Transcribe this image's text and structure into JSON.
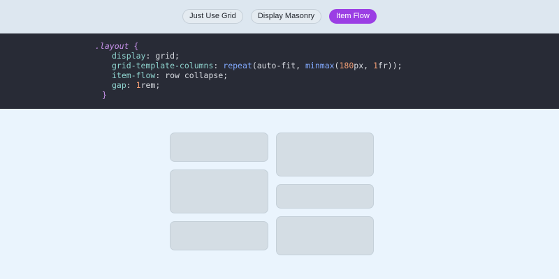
{
  "tabs": [
    {
      "label": "Just Use Grid",
      "active": false
    },
    {
      "label": "Display Masonry",
      "active": false
    },
    {
      "label": "Item Flow",
      "active": true
    }
  ],
  "code": {
    "selector": ".layout",
    "open_brace": "{",
    "close_brace": "}",
    "display_prop": "display",
    "display_val": "grid",
    "gtc_prop": "grid-template-columns",
    "gtc_fn_repeat": "repeat",
    "gtc_arg_autofit": "auto-fit",
    "gtc_fn_minmax": "minmax",
    "gtc_num_180": "180",
    "gtc_unit_px": "px",
    "gtc_num_1": "1",
    "gtc_unit_fr": "fr",
    "itemflow_prop": "item-flow",
    "itemflow_val": "row collapse",
    "gap_prop": "gap",
    "gap_num": "1",
    "gap_unit": "rem"
  },
  "colors": {
    "accent": "#9b3ee4",
    "code_bg": "#282b36",
    "canvas_bg": "#eaf4fd",
    "card_bg": "#d4dde4"
  }
}
